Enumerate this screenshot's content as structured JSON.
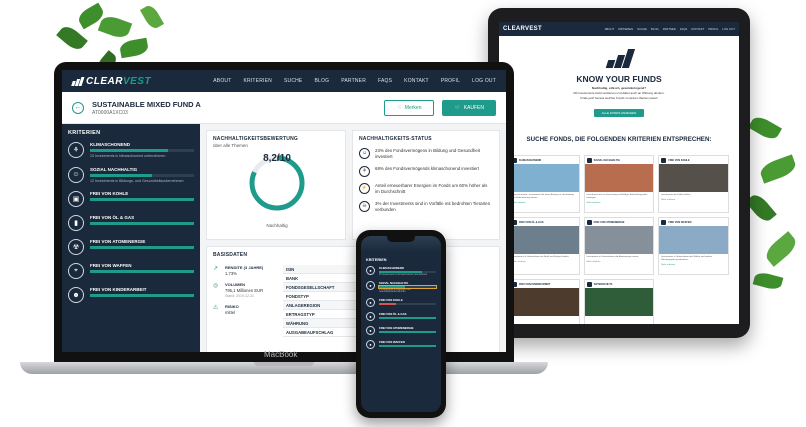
{
  "tablet": {
    "logo": "CLEARVEST",
    "nav": [
      "ABOUT",
      "KRITERIEN",
      "SUCHE",
      "BLOG",
      "PARTNER",
      "FAQS",
      "KONTAKT",
      "PROFIL",
      "LOG OUT"
    ],
    "hero_title": "KNOW YOUR FUNDS",
    "hero_sub1": "Nachhaltig, ethisch, gewinnbringend?",
    "hero_sub2": "Mit Investments Geld verdienen und dabei auch an Wirkung denken.",
    "hero_sub3": "Finde jetzt heraus welcher Fonds zu deinen Werten passt!",
    "hero_button": "ALLE FONDS ANZEIGEN",
    "section_title": "SUCHE FONDS, DIE FOLGENDEN KRITERIEN ENTSPRECHEN:",
    "cards": [
      {
        "title": "KLIMASCHONEND",
        "text": "Klimaschonend - Investments die einen Beitrag zur Vermeidung von Erderwärmung leisten.",
        "link": "Mehr erfahren",
        "color": "#7fb0cf"
      },
      {
        "title": "SOZIAL NACHHALTIG",
        "text": "Investments die zur Erreichung nachhaltiger Entwicklungsziele beitragen.",
        "link": "Mehr erfahren",
        "color": "#b86e4e"
      },
      {
        "title": "FREI VON KOHLE",
        "text": "Investments die Kohle fördern.",
        "link": "Mehr erfahren",
        "color": "#55504a"
      },
      {
        "title": "FREI VON ÖL & GAS",
        "text": "Investments in Unternehmen die Erdöl und Erdgas fördern.",
        "link": "Mehr erfahren",
        "color": "#6d7f8c"
      },
      {
        "title": "FREI VON ATOMENERGIE",
        "text": "Investments in Unternehmen die Atomenergie nutzen.",
        "link": "Mehr erfahren",
        "color": "#86909a"
      },
      {
        "title": "FREI VON WAFFEN",
        "text": "Investments in Unternehmen die Waffen und andere Rüstungsgüter produzieren.",
        "link": "Mehr erfahren",
        "color": "#8aaac6"
      },
      {
        "title": "FREI VON KINDERARBEIT",
        "text": "",
        "link": "",
        "color": "#4d3b2e"
      },
      {
        "title": "ARTENSCHUTZ",
        "text": "",
        "link": "",
        "color": "#2f5d3a"
      },
      {
        "title": "",
        "text": "",
        "link": "",
        "color": "#ffffff"
      }
    ]
  },
  "laptop": {
    "logo_prefix": "CLEAR",
    "logo_suffix": "VEST",
    "nav": [
      "ABOUT",
      "KRITERIEN",
      "SUCHE",
      "BLOG",
      "PARTNER",
      "FAQS",
      "KONTAKT",
      "PROFIL",
      "LOG OUT"
    ],
    "fund_title": "SUSTAINABLE MIXED FUND A",
    "fund_isin": "AT0000A1XC03",
    "btn_watch": "Merken",
    "btn_buy": "KAUFEN",
    "brand": "MacBook",
    "criteria_heading": "KRITERIEN",
    "criteria": [
      {
        "name": "KLIMASCHONEND",
        "desc": "23 Investments in klimaschonend unternehmen",
        "icon": "⚘",
        "fill": 0.75
      },
      {
        "name": "SOZIAL NACHHALTIG",
        "desc": "12 Investments in Bildungs- und Gesundheitsunternehmen",
        "icon": "☺",
        "fill": 0.6
      },
      {
        "name": "FREI VON KOHLE",
        "desc": "",
        "icon": "▣",
        "fill": 1.0
      },
      {
        "name": "FREI VON ÖL & GAS",
        "desc": "",
        "icon": "▮",
        "fill": 1.0
      },
      {
        "name": "FREI VON ATOMENERGIE",
        "desc": "",
        "icon": "☢",
        "fill": 1.0
      },
      {
        "name": "FREI VON WAFFEN",
        "desc": "",
        "icon": "⌖",
        "fill": 1.0
      },
      {
        "name": "FREI VON KINDERARBEIT",
        "desc": "",
        "icon": "☻",
        "fill": 1.0
      }
    ],
    "rating": {
      "heading": "NACHHALTIGKEITSBEWERTUNG",
      "sub": "über alle Themen",
      "value": "8,2/10",
      "score": 8.2,
      "max": 10,
      "caption": "Nachhaltig"
    },
    "status": {
      "heading": "NACHHALTIGKEITS-STATUS",
      "rows": [
        "23% des Fondsvermögens in Bildung und Gesundheit investiert",
        "68% des Fondsvermögends klimaschonend investiert",
        "Anteil erneuerbarer Energien im Fonds um 60% höher als im Durchschnitt",
        "3% der Investments sind in Vorfälle mit bedrohten Tierarten verbunden"
      ]
    },
    "basis": {
      "heading": "BASISDATEN",
      "items": [
        {
          "label": "RENDITE (3 JAHRE)",
          "value": "1,73%",
          "note": ""
        },
        {
          "label": "VOLUMEN",
          "value": "795,1 Millionen EUR",
          "note": "Stand: 2019-12-31"
        },
        {
          "label": "RISIKO",
          "value": "mittel",
          "note": ""
        }
      ],
      "table": [
        "ISIN",
        "BANK",
        "FONDSGESELLSCHAFT",
        "FONDSTYP",
        "ANLAGEREGION",
        "ERTRAGSTYP",
        "WÄHRUNG",
        "AUSGABEAUFSCHLAG"
      ]
    }
  },
  "phone": {
    "heading": "KRITERIEN",
    "criteria": [
      {
        "name": "KLIMASCHONEND",
        "desc": "23 Investments in klimaschonend unternehmen",
        "fill": 0.75,
        "state": "ok"
      },
      {
        "name": "SOZIAL NACHHALTIG",
        "desc": "3 Investments in Bildungs- und Gesundheitsunternehmen",
        "fill": 0.45,
        "state": "warn"
      },
      {
        "name": "FREI VON KOHLE",
        "desc": "",
        "fill": 0.3,
        "state": "bad"
      },
      {
        "name": "FREI VON ÖL & GAS",
        "desc": "",
        "fill": 1.0,
        "state": "ok"
      },
      {
        "name": "FREI VON ATOMENERGIE",
        "desc": "",
        "fill": 1.0,
        "state": "ok"
      },
      {
        "name": "FREI VON WAFFEN",
        "desc": "",
        "fill": 1.0,
        "state": "ok"
      }
    ]
  },
  "colors": {
    "navy": "#1a2a3c",
    "teal": "#1e9b8a",
    "warn": "#e0a43a",
    "bad": "#d9534f"
  }
}
